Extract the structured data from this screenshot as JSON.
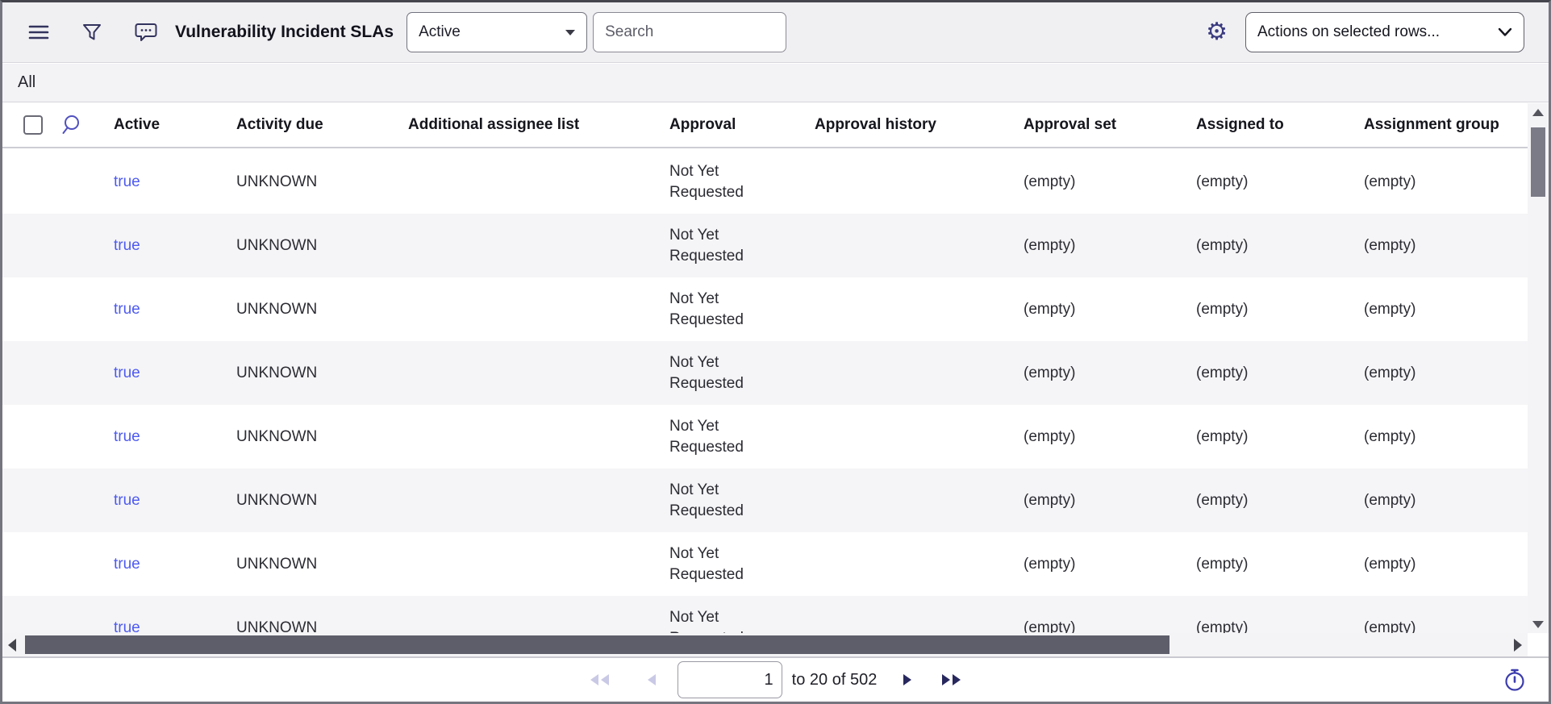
{
  "toolbar": {
    "title": "Vulnerability Incident SLAs",
    "filter_value": "Active",
    "search_placeholder": "Search",
    "actions_label": "Actions on selected rows...",
    "icons": [
      "hamburger-menu",
      "filter-funnel",
      "chat-bubble",
      "gear",
      "caret-down",
      "chevron-down"
    ]
  },
  "breadcrumb": {
    "label": "All"
  },
  "table": {
    "columns": [
      "Active",
      "Activity due",
      "Additional assignee list",
      "Approval",
      "Approval history",
      "Approval set",
      "Assigned to",
      "Assignment group"
    ],
    "rows": [
      {
        "active": "true",
        "activity_due": "UNKNOWN",
        "additional_assignee_list": "",
        "approval": "Not Yet Requested",
        "approval_history": "",
        "approval_set": "(empty)",
        "assigned_to": "(empty)",
        "assignment_group": "(empty)"
      },
      {
        "active": "true",
        "activity_due": "UNKNOWN",
        "additional_assignee_list": "",
        "approval": "Not Yet Requested",
        "approval_history": "",
        "approval_set": "(empty)",
        "assigned_to": "(empty)",
        "assignment_group": "(empty)"
      },
      {
        "active": "true",
        "activity_due": "UNKNOWN",
        "additional_assignee_list": "",
        "approval": "Not Yet Requested",
        "approval_history": "",
        "approval_set": "(empty)",
        "assigned_to": "(empty)",
        "assignment_group": "(empty)"
      },
      {
        "active": "true",
        "activity_due": "UNKNOWN",
        "additional_assignee_list": "",
        "approval": "Not Yet Requested",
        "approval_history": "",
        "approval_set": "(empty)",
        "assigned_to": "(empty)",
        "assignment_group": "(empty)"
      },
      {
        "active": "true",
        "activity_due": "UNKNOWN",
        "additional_assignee_list": "",
        "approval": "Not Yet Requested",
        "approval_history": "",
        "approval_set": "(empty)",
        "assigned_to": "(empty)",
        "assignment_group": "(empty)"
      },
      {
        "active": "true",
        "activity_due": "UNKNOWN",
        "additional_assignee_list": "",
        "approval": "Not Yet Requested",
        "approval_history": "",
        "approval_set": "(empty)",
        "assigned_to": "(empty)",
        "assignment_group": "(empty)"
      },
      {
        "active": "true",
        "activity_due": "UNKNOWN",
        "additional_assignee_list": "",
        "approval": "Not Yet Requested",
        "approval_history": "",
        "approval_set": "(empty)",
        "assigned_to": "(empty)",
        "assignment_group": "(empty)"
      },
      {
        "active": "true",
        "activity_due": "UNKNOWN",
        "additional_assignee_list": "",
        "approval": "Not Yet Requested",
        "approval_history": "",
        "approval_set": "(empty)",
        "assigned_to": "(empty)",
        "assignment_group": "(empty)"
      }
    ]
  },
  "pagination": {
    "page_value": "1",
    "range_text": "to 20 of 502",
    "icons": [
      "first-page",
      "previous-page",
      "next-page",
      "last-page",
      "stopwatch"
    ]
  },
  "colors": {
    "link": "#4d5af0",
    "toolbar_bg": "#f0f0f3",
    "stripe_bg": "#f5f5f7",
    "scrollbar_thumb": "#5e5e6b",
    "icon_navy": "#33335e",
    "pager_disabled": "#c9c9e6",
    "pager_enabled": "#28285e"
  }
}
